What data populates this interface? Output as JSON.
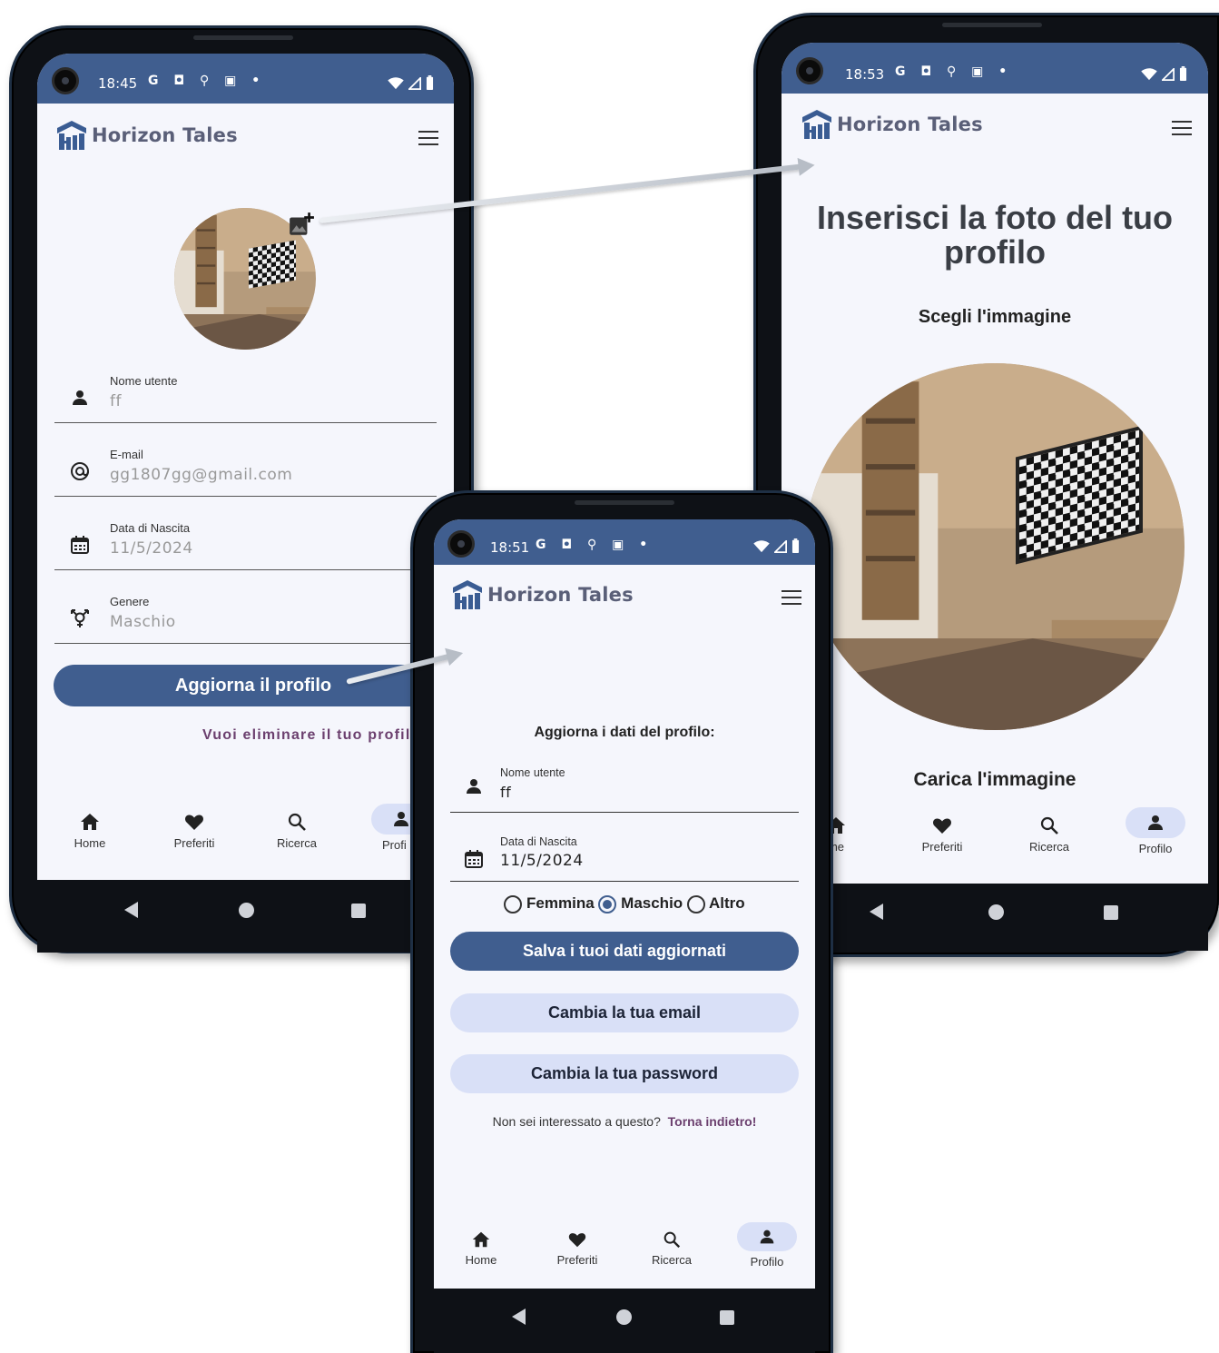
{
  "app": {
    "name": "Horizon Tales"
  },
  "nav": {
    "home": "Home",
    "favorites": "Preferiti",
    "search": "Ricerca",
    "profile": "Profilo",
    "profile_cut": "Profi",
    "home_cut": "me"
  },
  "phone1": {
    "time": "18:45",
    "fields": {
      "username_label": "Nome utente",
      "username_value": "ff",
      "email_label": "E-mail",
      "email_value": "gg1807gg@gmail.com",
      "birth_label": "Data di Nascita",
      "birth_value": "11/5/2024",
      "gender_label": "Genere",
      "gender_value": "Maschio"
    },
    "update_button": "Aggiorna il profilo",
    "delete_link": "Vuoi eliminare il tuo profil"
  },
  "phone2": {
    "time": "18:53",
    "title": "Inserisci la foto del tuo profilo",
    "choose_label": "Scegli l'immagine",
    "upload_label": "Carica l'immagine"
  },
  "phone3": {
    "time": "18:51",
    "heading": "Aggiorna i dati del profilo:",
    "username_label": "Nome utente",
    "username_value": "ff",
    "birth_label": "Data di Nascita",
    "birth_value": "11/5/2024",
    "gender_options": [
      "Femmina",
      "Maschio",
      "Altro"
    ],
    "gender_selected": "Maschio",
    "save_button": "Salva i tuoi dati aggiornati",
    "email_button": "Cambia la tua email",
    "password_button": "Cambia la tua password",
    "footer_question": "Non sei interessato a questo?",
    "footer_link": "Torna indietro!"
  },
  "colors": {
    "primary": "#405e8f",
    "secondary": "#d9e0f7",
    "link": "#6b3f6e",
    "background": "#f5f6fc"
  }
}
